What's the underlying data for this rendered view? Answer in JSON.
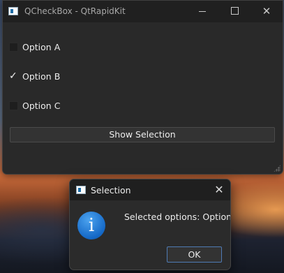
{
  "main_window": {
    "title": "QCheckBox - QtRapidKit",
    "caption": {
      "minimize_glyph": "minimize-icon",
      "maximize_glyph": "maximize-icon",
      "close_glyph": "✕"
    },
    "options": [
      {
        "label": "Option A",
        "checked": false
      },
      {
        "label": "Option B",
        "checked": true
      },
      {
        "label": "Option C",
        "checked": false
      }
    ],
    "check_mark": "✓",
    "show_button_label": "Show Selection"
  },
  "dialog": {
    "title": "Selection",
    "close_glyph": "✕",
    "icon_glyph": "i",
    "message": "Selected options: Option B",
    "ok_label": "OK",
    "accent_color": "#1569c7"
  }
}
